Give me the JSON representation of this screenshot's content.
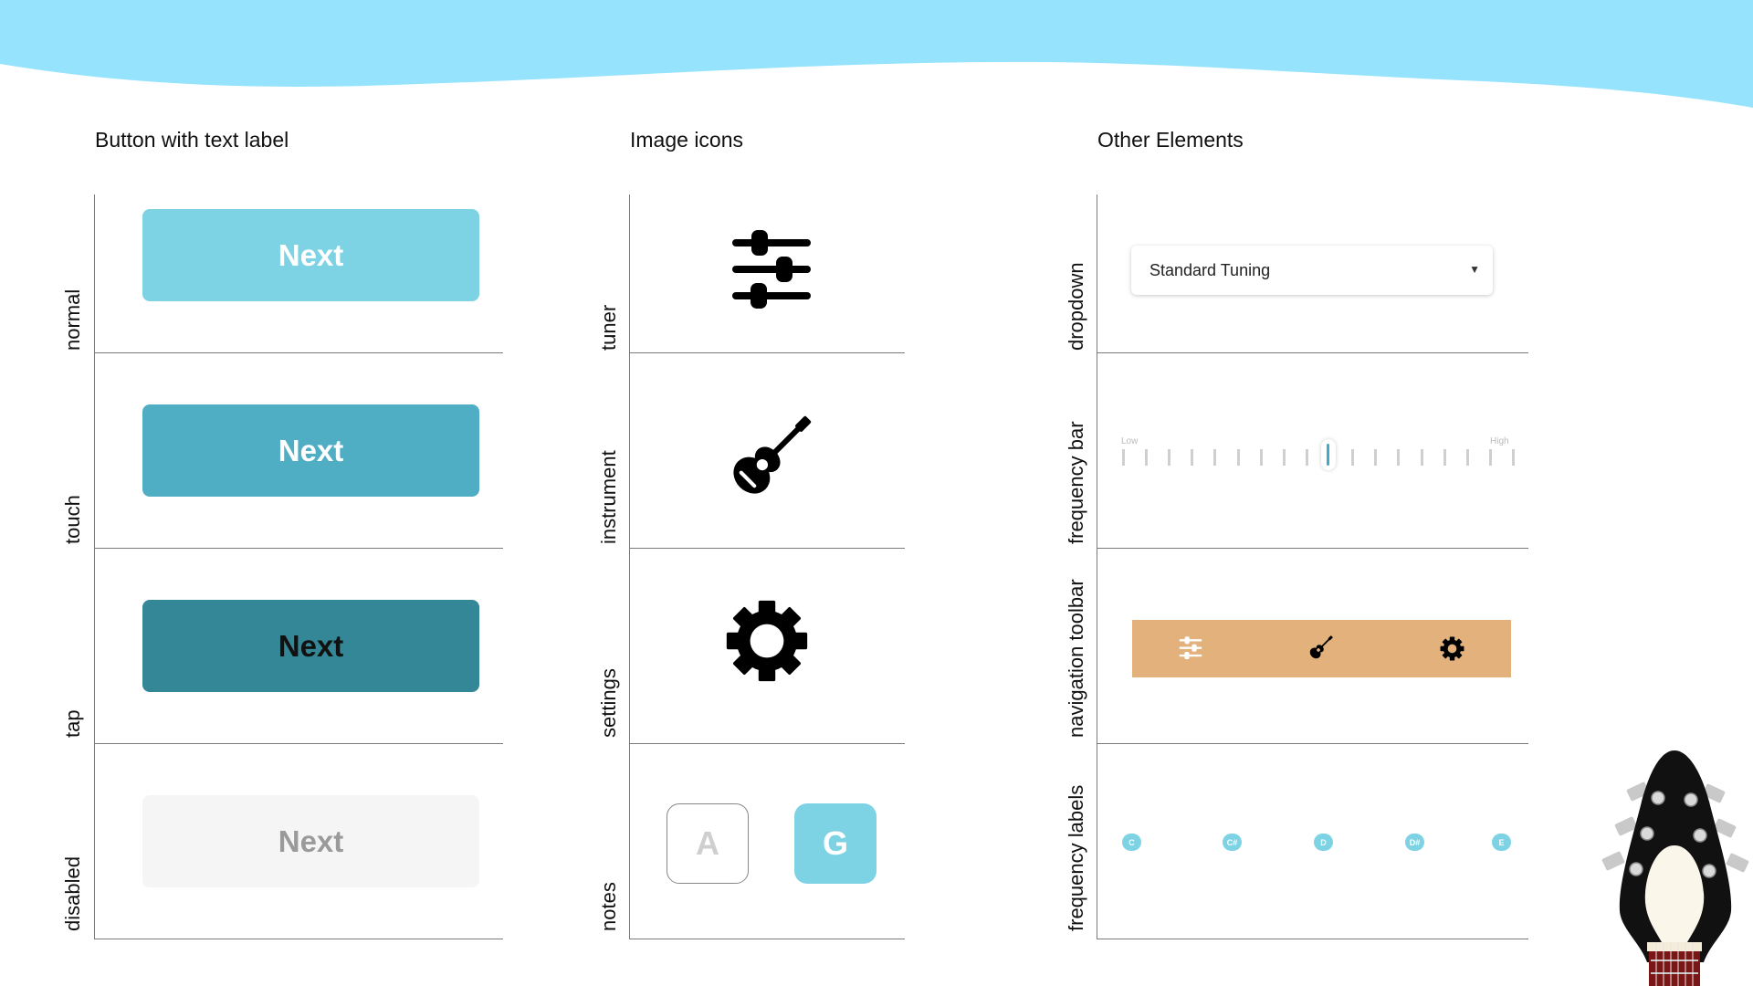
{
  "sections": {
    "buttons": {
      "title": "Button with text label",
      "rows": {
        "normal": "normal",
        "touch": "touch",
        "tap": "tap",
        "disabled": "disabled"
      },
      "button_label": "Next"
    },
    "icons": {
      "title": "Image icons",
      "rows": {
        "tuner": "tuner",
        "instrument": "instrument",
        "settings": "settings",
        "notes": "notes"
      },
      "note_a": "A",
      "note_g": "G"
    },
    "other": {
      "title": "Other Elements",
      "rows": {
        "dropdown": "dropdown",
        "frequency_bar": "frequency bar",
        "navigation_toolbar": "navigation toolbar",
        "frequency_labels": "frequency labels"
      },
      "dropdown_value": "Standard Tuning",
      "freq_low": "Low",
      "freq_high": "High",
      "freq_level": 0.53,
      "note_labels": [
        "C",
        "C#",
        "D",
        "D#",
        "E"
      ]
    }
  },
  "colors": {
    "wave": "#95e3fd",
    "normal": "#7dd3e4",
    "touch": "#50aec4",
    "tap": "#348797",
    "disabled": "#f5f5f5",
    "toolbar": "#e2b17c",
    "accent": "#3fa9c9"
  },
  "icons": [
    "sliders-icon",
    "guitar-icon",
    "gear-icon",
    "guitar-headstock-icon"
  ]
}
